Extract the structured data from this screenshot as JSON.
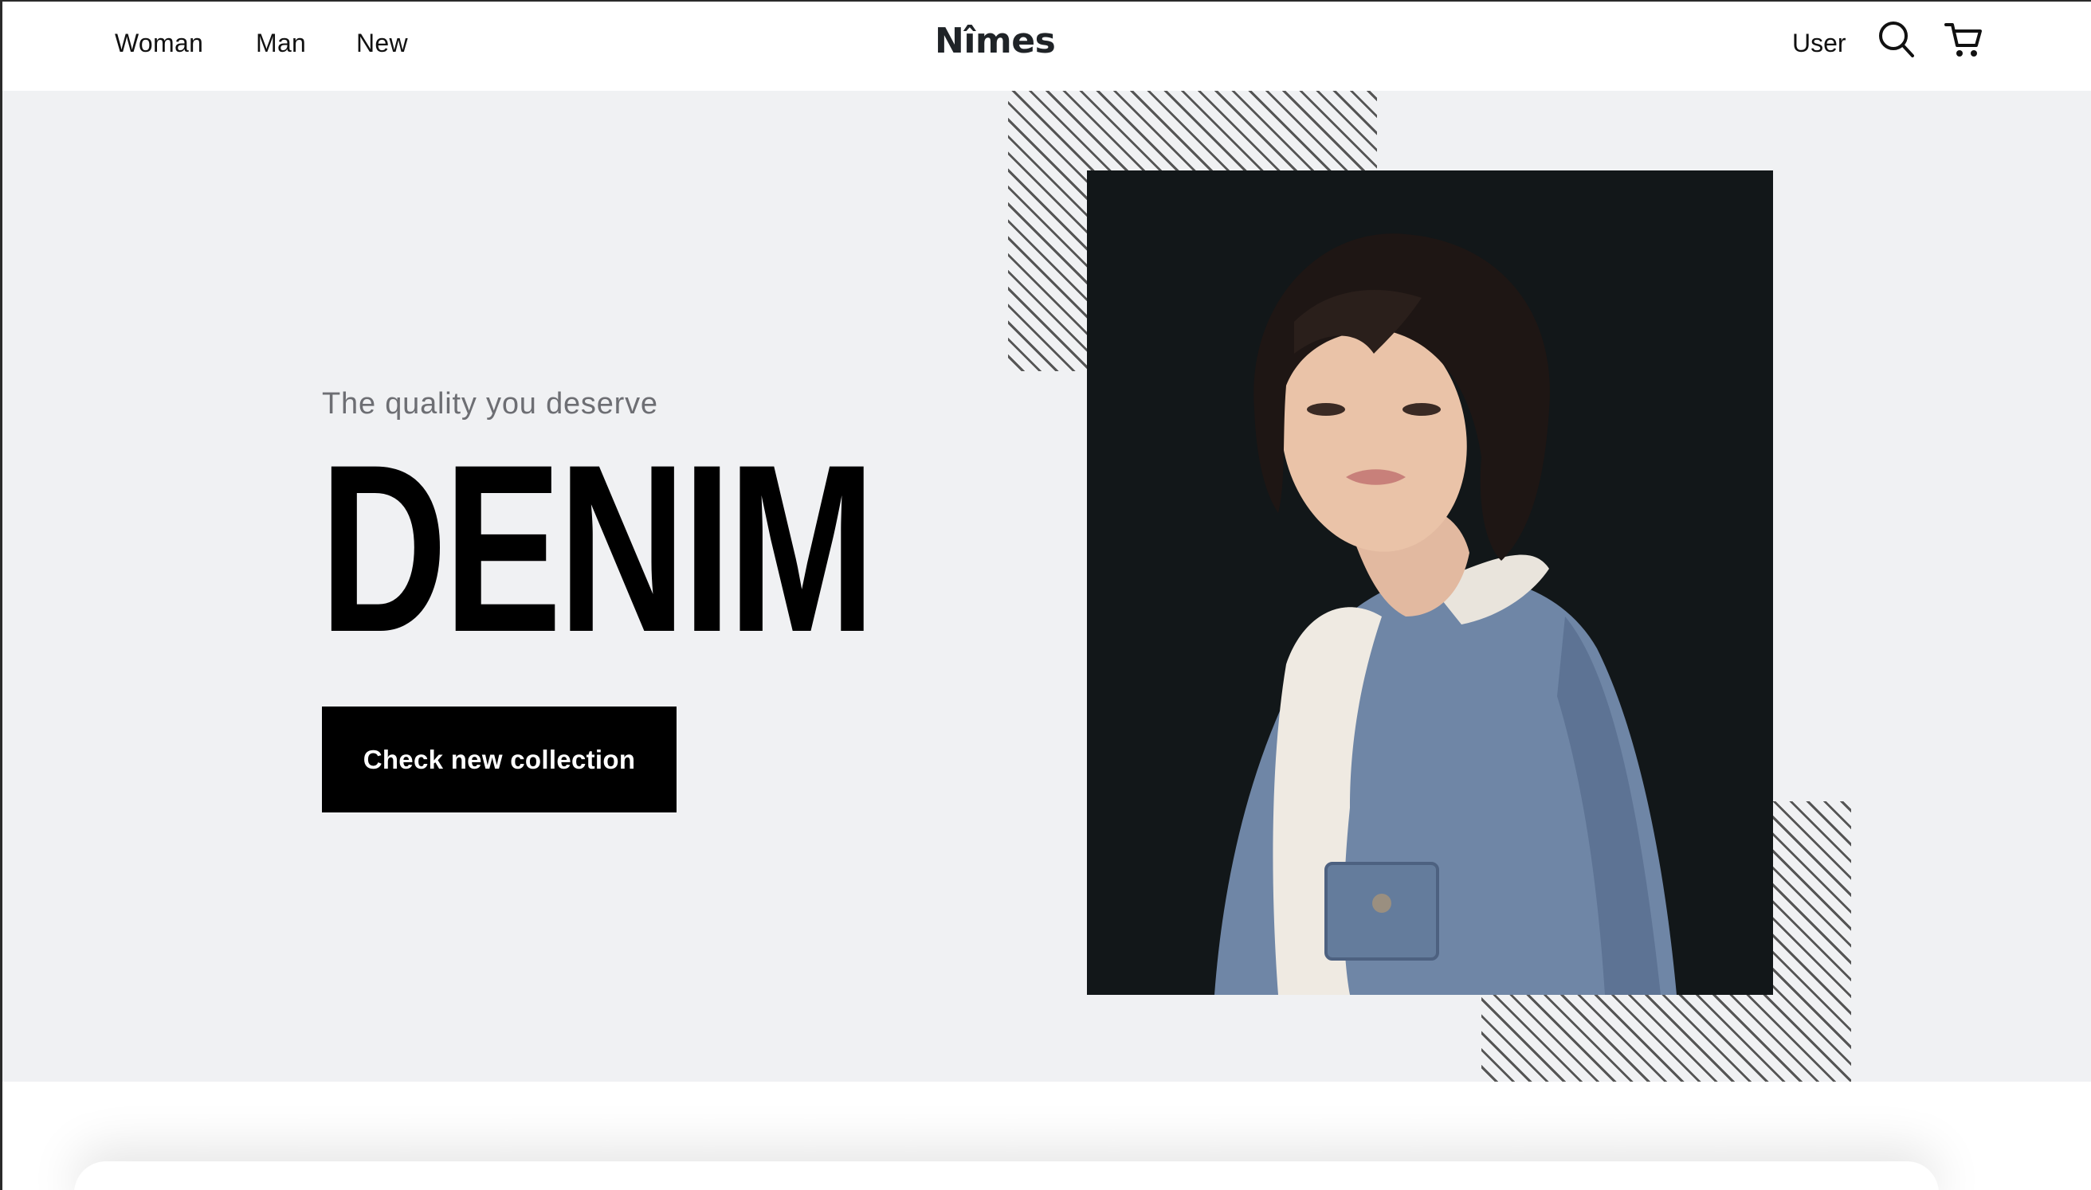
{
  "header": {
    "nav": [
      {
        "label": "Woman"
      },
      {
        "label": "Man"
      },
      {
        "label": "New"
      }
    ],
    "logo": "Nîmes",
    "user_label": "User",
    "icons": {
      "search": "search-icon",
      "cart": "cart-icon"
    }
  },
  "hero": {
    "tagline": "The quality you deserve",
    "headline": "DENIM",
    "cta_label": "Check new collection",
    "photo_alt": "photo",
    "background_color": "#f0f1f3",
    "accent_color": "#000000"
  }
}
